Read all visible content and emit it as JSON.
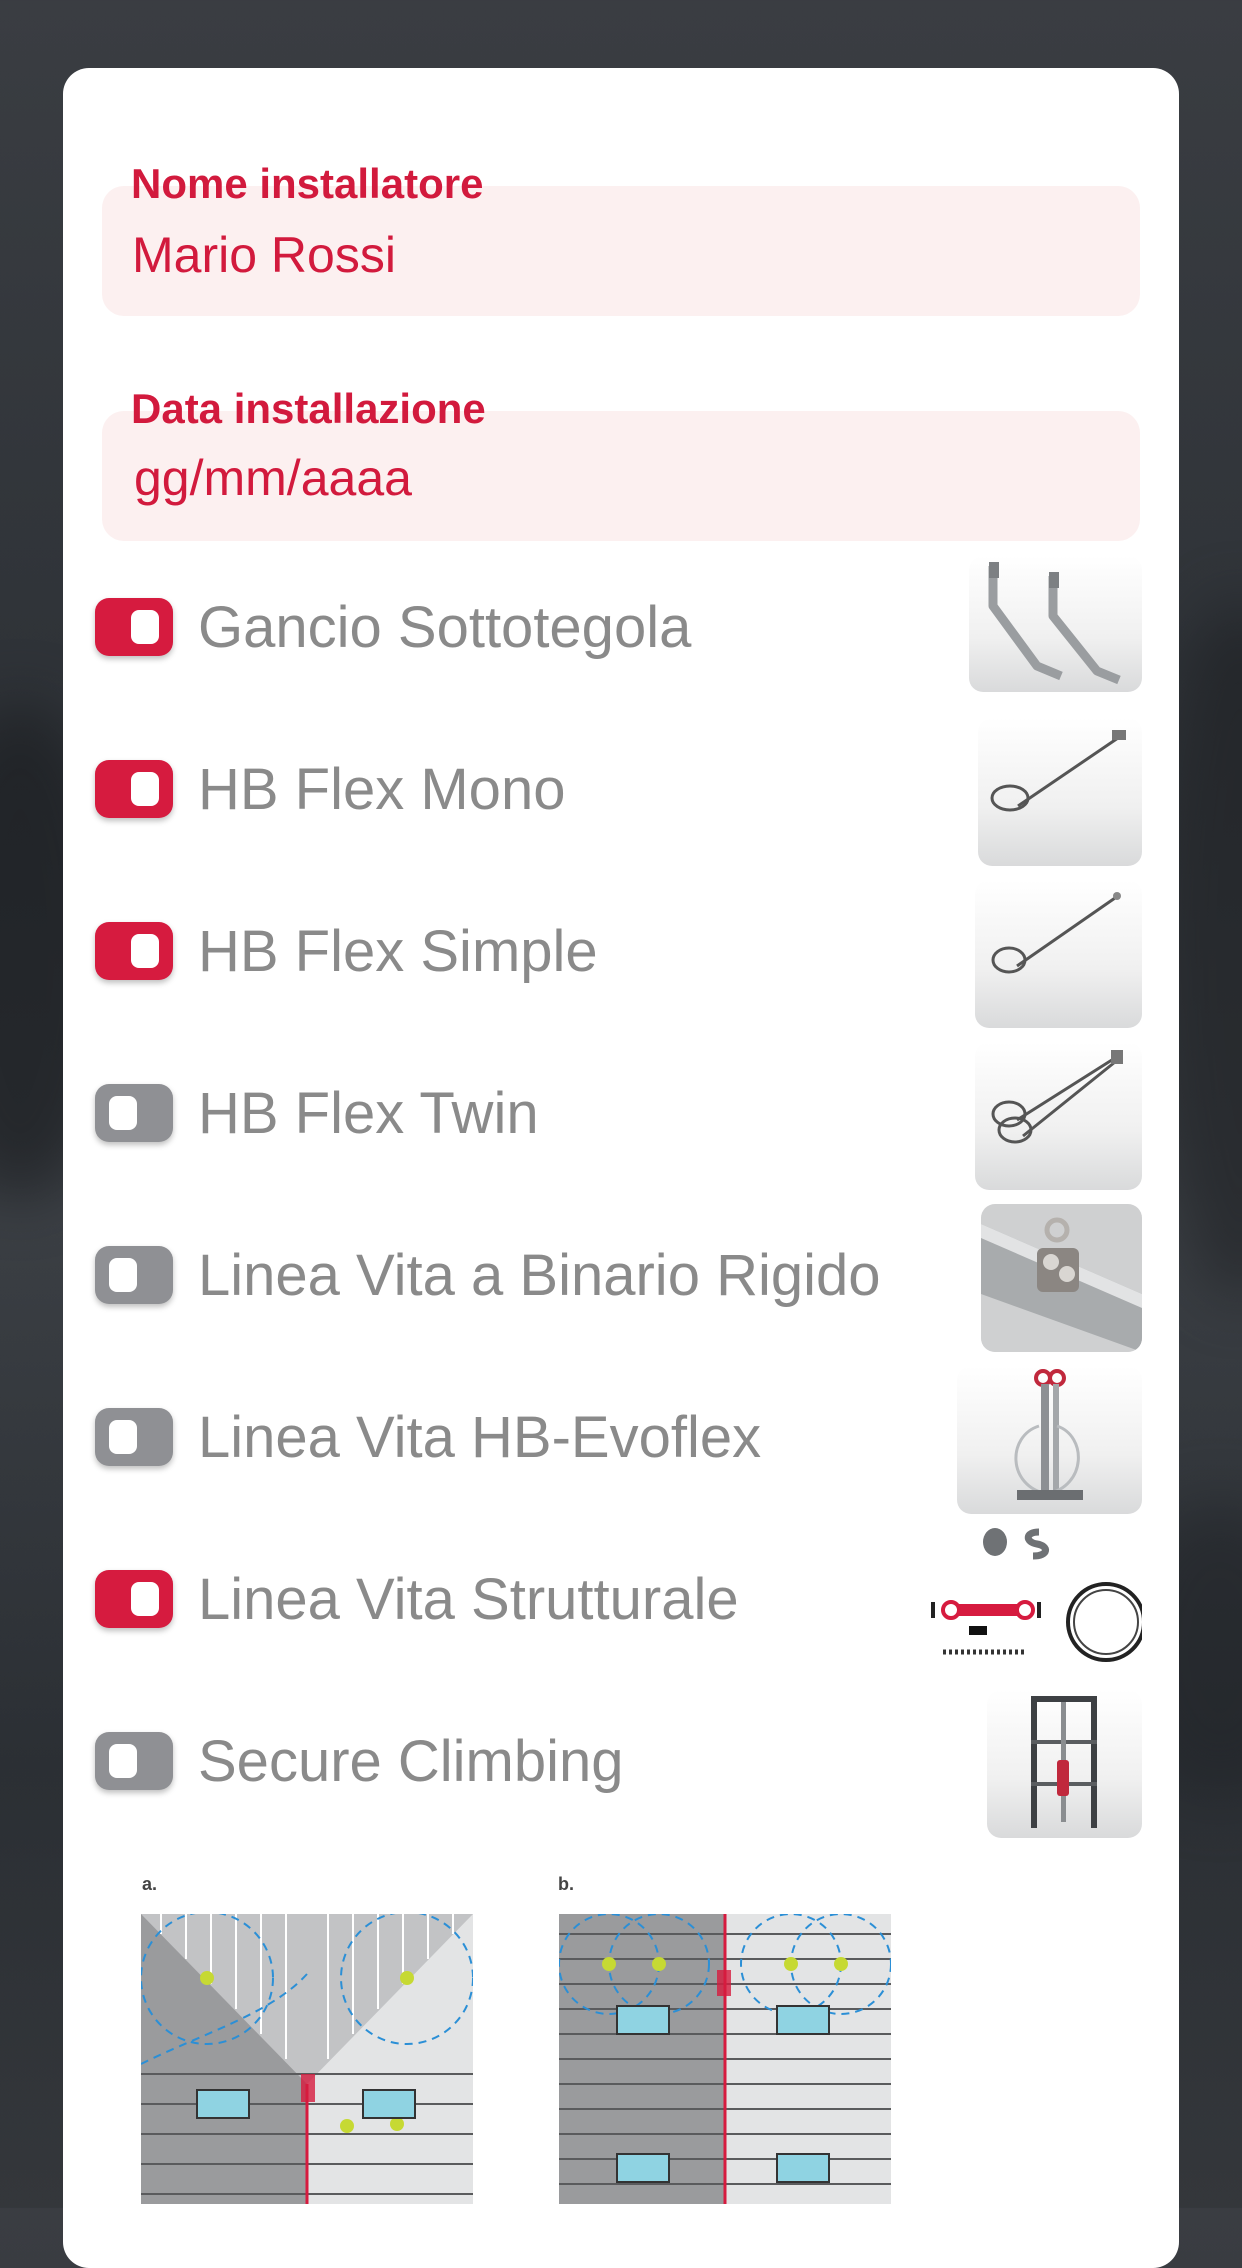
{
  "form": {
    "installer": {
      "label": "Nome installatore",
      "value": "Mario Rossi"
    },
    "date": {
      "label": "Data installazione",
      "placeholder": "gg/mm/aaaa"
    }
  },
  "products": [
    {
      "label": "Gancio Sottotegola",
      "checked": true,
      "icon": "roof-hook-icon"
    },
    {
      "label": "HB Flex Mono",
      "checked": true,
      "icon": "cable-single-icon"
    },
    {
      "label": "HB Flex Simple",
      "checked": true,
      "icon": "cable-simple-icon"
    },
    {
      "label": "HB Flex Twin",
      "checked": false,
      "icon": "cable-twin-icon"
    },
    {
      "label": "Linea Vita a Binario Rigido",
      "checked": false,
      "icon": "rail-lifeline-icon"
    },
    {
      "label": "Linea Vita HB-Evoflex",
      "checked": false,
      "icon": "evoflex-post-icon"
    },
    {
      "label": "Linea Vita Strutturale",
      "checked": true,
      "icon": "structural-kit-icon"
    },
    {
      "label": "Secure Climbing",
      "checked": false,
      "icon": "ladder-icon"
    }
  ],
  "diagrams": {
    "a_label": "a.",
    "b_label": "b."
  },
  "colors": {
    "accent": "#d61b3f",
    "toggle_off": "#8f9094",
    "field_bg": "#fcf0f0",
    "label_grey": "#8a8a8a"
  }
}
